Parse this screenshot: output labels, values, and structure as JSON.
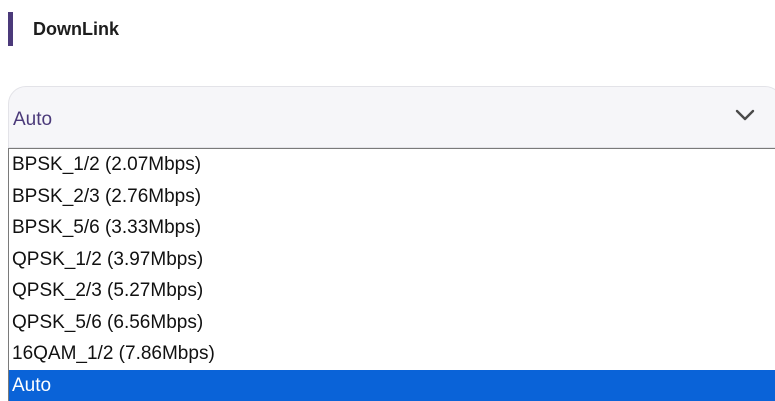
{
  "section": {
    "title": "DownLink"
  },
  "select": {
    "current_value": "Auto",
    "chevron_icon": "chevron-down-icon"
  },
  "options": [
    {
      "label": "BPSK_1/2 (2.07Mbps)",
      "selected": false
    },
    {
      "label": "BPSK_2/3 (2.76Mbps)",
      "selected": false
    },
    {
      "label": "BPSK_5/6 (3.33Mbps)",
      "selected": false
    },
    {
      "label": "QPSK_1/2 (3.97Mbps)",
      "selected": false
    },
    {
      "label": "QPSK_2/3 (5.27Mbps)",
      "selected": false
    },
    {
      "label": "QPSK_5/6 (6.56Mbps)",
      "selected": false
    },
    {
      "label": "16QAM_1/2 (7.86Mbps)",
      "selected": false
    },
    {
      "label": "Auto",
      "selected": true
    }
  ],
  "colors": {
    "accent": "#4b3a7a",
    "selection_highlight": "#0a63d8",
    "select_background": "#f6f6f9"
  }
}
